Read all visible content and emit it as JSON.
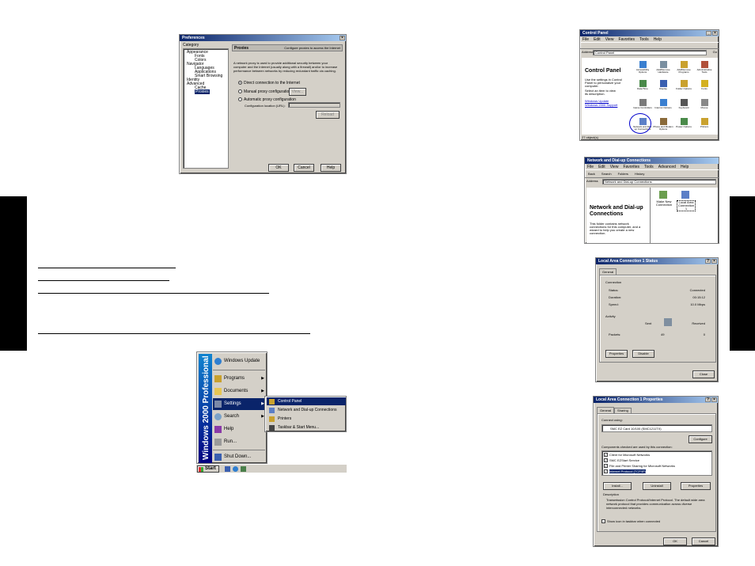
{
  "preferences": {
    "title": "Preferences",
    "category_label": "Category",
    "tree": [
      "Appearance",
      "Fonts",
      "Colors",
      "Navigator",
      "Languages",
      "Applications",
      "Smart Browsing",
      "Identity",
      "Advanced",
      "Cache",
      "Proxies"
    ],
    "panel_title": "Proxies",
    "panel_subtitle": "Configure proxies to access the Internet",
    "description": "A network proxy is used to provide additional security between your computer and the Internet (usually along with a firewall) and/or to increase performance between networks by reducing redundant traffic via caching.",
    "options": [
      "Direct connection to the Internet",
      "Manual proxy configuration",
      "Automatic proxy configuration"
    ],
    "view_label": "View...",
    "config_location_label": "Configuration location (URL):",
    "reload_label": "Reload",
    "ok_label": "OK",
    "cancel_label": "Cancel",
    "help_label": "Help"
  },
  "control_panel": {
    "title": "Control Panel",
    "menu": [
      "File",
      "Edit",
      "View",
      "Favorites",
      "Tools",
      "Help"
    ],
    "address_label": "Address",
    "address_value": "Control Panel",
    "go_label": "Go",
    "heading": "Control Panel",
    "blurb": "Use the settings in Control Panel to personalize your computer.",
    "blurb2": "Select an item to view its description.",
    "link1": "Windows Update",
    "link2": "Windows 2000 Support",
    "icons": [
      "Accessibility Options",
      "Add/Remove Hardware",
      "Add/Remove Programs",
      "Administrative Tools",
      "Date/Time",
      "Display",
      "Folder Options",
      "Fonts",
      "Game Controllers",
      "Internet Options",
      "Keyboard",
      "Mouse",
      "Network and Dial-up Connections",
      "Phone and Modem Options",
      "Power Options",
      "Printers"
    ],
    "status": "27 object(s)"
  },
  "network": {
    "title": "Network and Dial-up Connections",
    "menu": [
      "File",
      "Edit",
      "View",
      "Favorites",
      "Tools",
      "Advanced",
      "Help"
    ],
    "toolbar": [
      "Back",
      "Search",
      "Folders",
      "History"
    ],
    "address_label": "Address",
    "address_value": "Network and Dial-up Connections",
    "heading": "Network and Dial-up Connections",
    "blurb": "This folder contains network connections for this computer, and a wizard to help you create a new connection.",
    "items": [
      "Make New Connection",
      "Local Area Connection 1"
    ]
  },
  "status_dialog": {
    "title": "Local Area Connection 1 Status",
    "tab": "General",
    "connection_group": "Connection",
    "rows": [
      {
        "label": "Status:",
        "value": "Connected"
      },
      {
        "label": "Duration:",
        "value": "00:15:12"
      },
      {
        "label": "Speed:",
        "value": "10.0 Mbps"
      }
    ],
    "activity_group": "Activity",
    "sent_label": "Sent",
    "received_label": "Received",
    "packets_label": "Packets:",
    "packets_sent": "49",
    "packets_received": "0",
    "properties_label": "Properties",
    "disable_label": "Disable",
    "close_label": "Close"
  },
  "properties_dialog": {
    "title": "Local Area Connection 1 Properties",
    "tabs": [
      "General",
      "Sharing"
    ],
    "connect_using_label": "Connect using:",
    "adapter": "SMC EZ Card 10/100 (SMC1211TX)",
    "configure_label": "Configure",
    "components_label": "Components checked are used by this connection:",
    "components": [
      "Client for Microsoft Networks",
      "SMC EZStart Service",
      "File and Printer Sharing for Microsoft Networks",
      "Internet Protocol (TCP/IP)"
    ],
    "install_label": "Install...",
    "uninstall_label": "Uninstall",
    "properties_label": "Properties",
    "description_label": "Description",
    "description": "Transmission Control Protocol/Internet Protocol. The default wide area network protocol that provides communication across diverse interconnected networks.",
    "show_icon_label": "Show icon in taskbar when connected",
    "ok_label": "OK",
    "cancel_label": "Cancel"
  },
  "start_menu": {
    "band_text": "Windows 2000 Professional",
    "items": [
      "Windows Update",
      "Programs",
      "Documents",
      "Settings",
      "Search",
      "Help",
      "Run...",
      "Shut Down..."
    ],
    "submenu": [
      "Control Panel",
      "Network and Dial-up Connections",
      "Printers",
      "Taskbar & Start Menu..."
    ],
    "start_label": "Start"
  },
  "colors": {
    "titlebar": "#0a246a",
    "selection": "#0a246a",
    "window_face": "#d4d0c8"
  }
}
